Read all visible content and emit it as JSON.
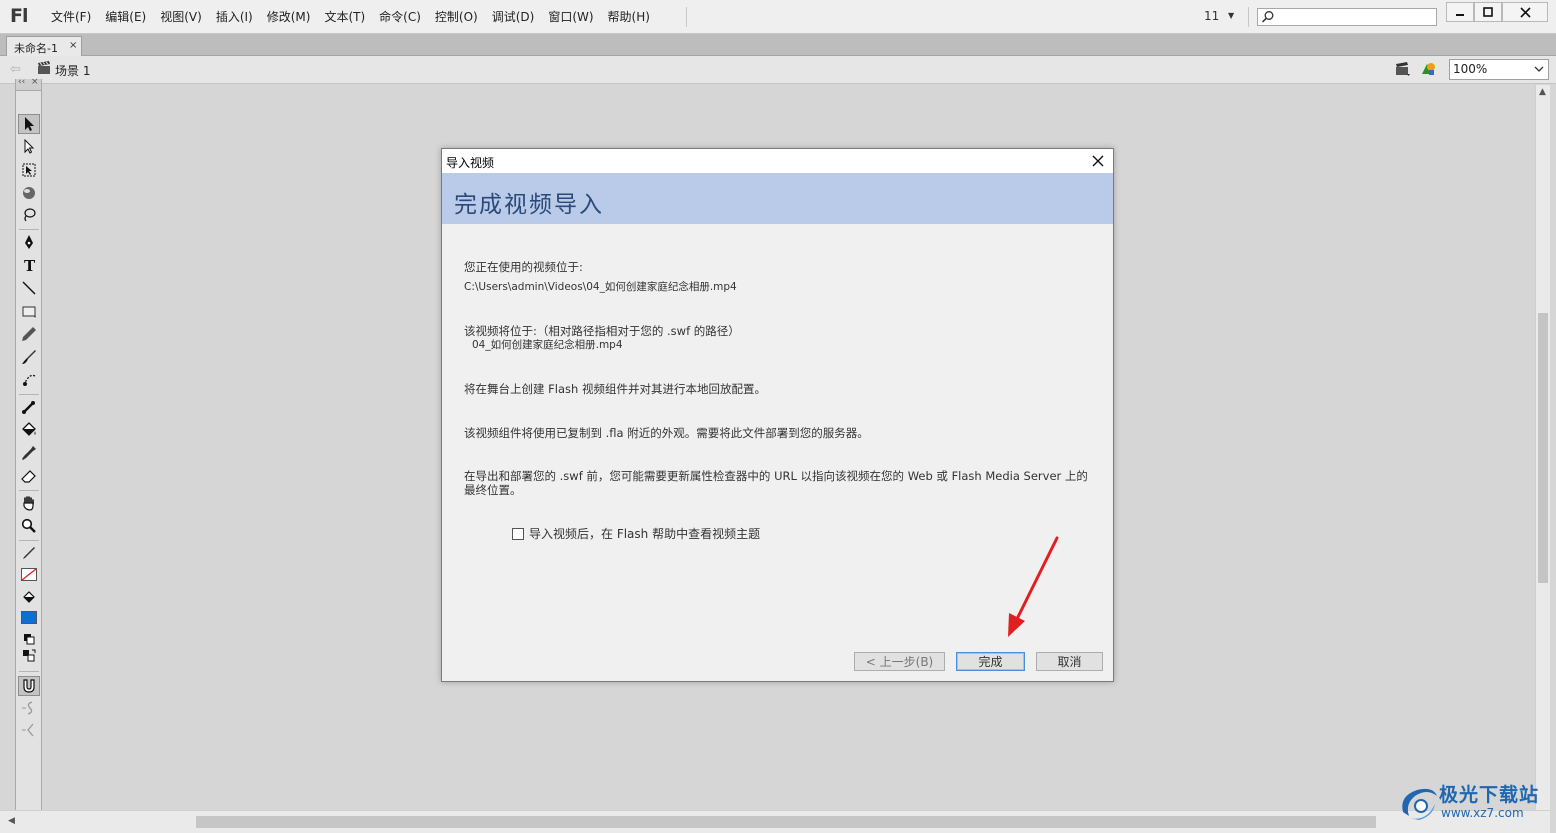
{
  "app": {
    "logo": "Fl",
    "menu": [
      "文件(F)",
      "编辑(E)",
      "视图(V)",
      "插入(I)",
      "修改(M)",
      "文本(T)",
      "命令(C)",
      "控制(O)",
      "调试(D)",
      "窗口(W)",
      "帮助(H)"
    ],
    "workspace_number": "11",
    "search_placeholder": ""
  },
  "document_tab": {
    "name": "未命名-1",
    "close": "×"
  },
  "editbar": {
    "scene_label": "场景 1",
    "zoom": "100%"
  },
  "dialog": {
    "title": "导入视频",
    "heading": "完成视频导入",
    "video_location_label": "您正在使用的视频位于:",
    "video_location_path": "C:\\Users\\admin\\Videos\\04_如何创建家庭纪念相册.mp4",
    "video_target_label": "该视频将位于:（相对路径指相对于您的 .swf 的路径）",
    "video_target_path": "04_如何创建家庭纪念相册.mp4",
    "info_flash_component": "将在舞台上创建 Flash 视频组件并对其进行本地回放配置。",
    "info_skin": "该视频组件将使用已复制到 .fla 附近的外观。需要将此文件部署到您的服务器。",
    "info_export": "在导出和部署您的 .swf 前，您可能需要更新属性检查器中的 URL 以指向该视频在您的 Web 或 Flash Media Server 上的最终位置。",
    "checkbox_label": "导入视频后，在 Flash 帮助中查看视频主题",
    "checkbox_checked": false,
    "buttons": {
      "back": "< 上一步(B)",
      "finish": "完成",
      "cancel": "取消"
    }
  },
  "colors": {
    "banner": "#b9cbe8",
    "heading_text": "#2b4a7a",
    "fill_color": "#0a6fd6",
    "annotation_arrow": "#e02020",
    "watermark": "#1f67b0"
  },
  "watermark": {
    "title": "极光下载站",
    "url": "www.xz7.com"
  }
}
